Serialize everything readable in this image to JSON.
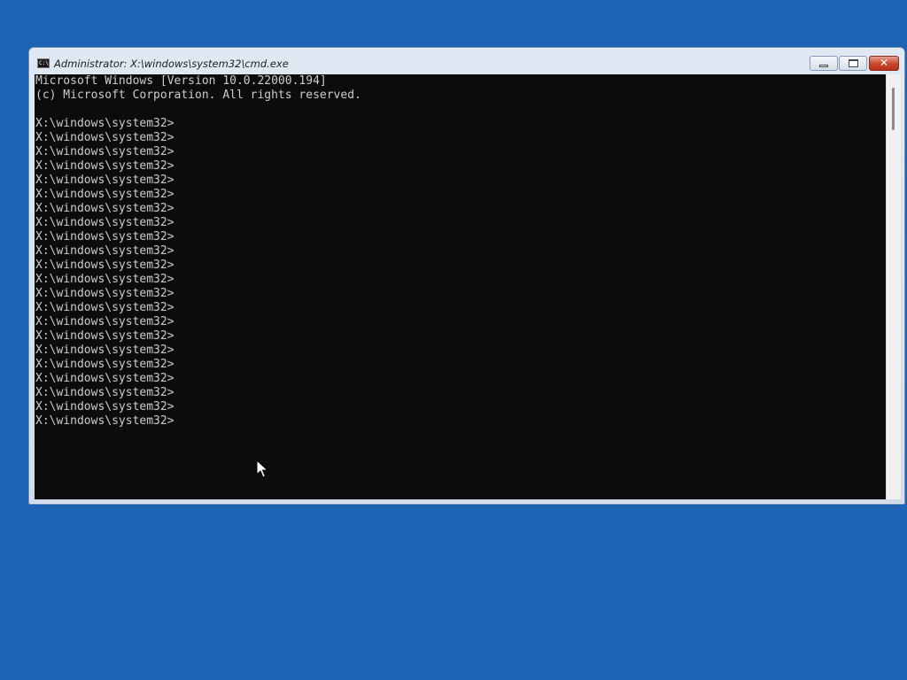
{
  "window": {
    "title": "Administrator: X:\\windows\\system32\\cmd.exe",
    "icon": "cmd-icon",
    "icon_text": "C:\\",
    "close_glyph": "✕"
  },
  "console": {
    "lines": [
      "Microsoft Windows [Version 10.0.22000.194]",
      "(c) Microsoft Corporation. All rights reserved.",
      "",
      "X:\\windows\\system32>",
      "X:\\windows\\system32>",
      "X:\\windows\\system32>",
      "X:\\windows\\system32>",
      "X:\\windows\\system32>",
      "X:\\windows\\system32>",
      "X:\\windows\\system32>",
      "X:\\windows\\system32>",
      "X:\\windows\\system32>",
      "X:\\windows\\system32>",
      "X:\\windows\\system32>",
      "X:\\windows\\system32>",
      "X:\\windows\\system32>",
      "X:\\windows\\system32>",
      "X:\\windows\\system32>",
      "X:\\windows\\system32>",
      "X:\\windows\\system32>",
      "X:\\windows\\system32>",
      "X:\\windows\\system32>",
      "X:\\windows\\system32>",
      "X:\\windows\\system32>",
      "X:\\windows\\system32>"
    ]
  },
  "colors": {
    "desktop": "#1f64b4",
    "console_bg": "#0c0c0c",
    "console_fg": "#cccccc"
  }
}
